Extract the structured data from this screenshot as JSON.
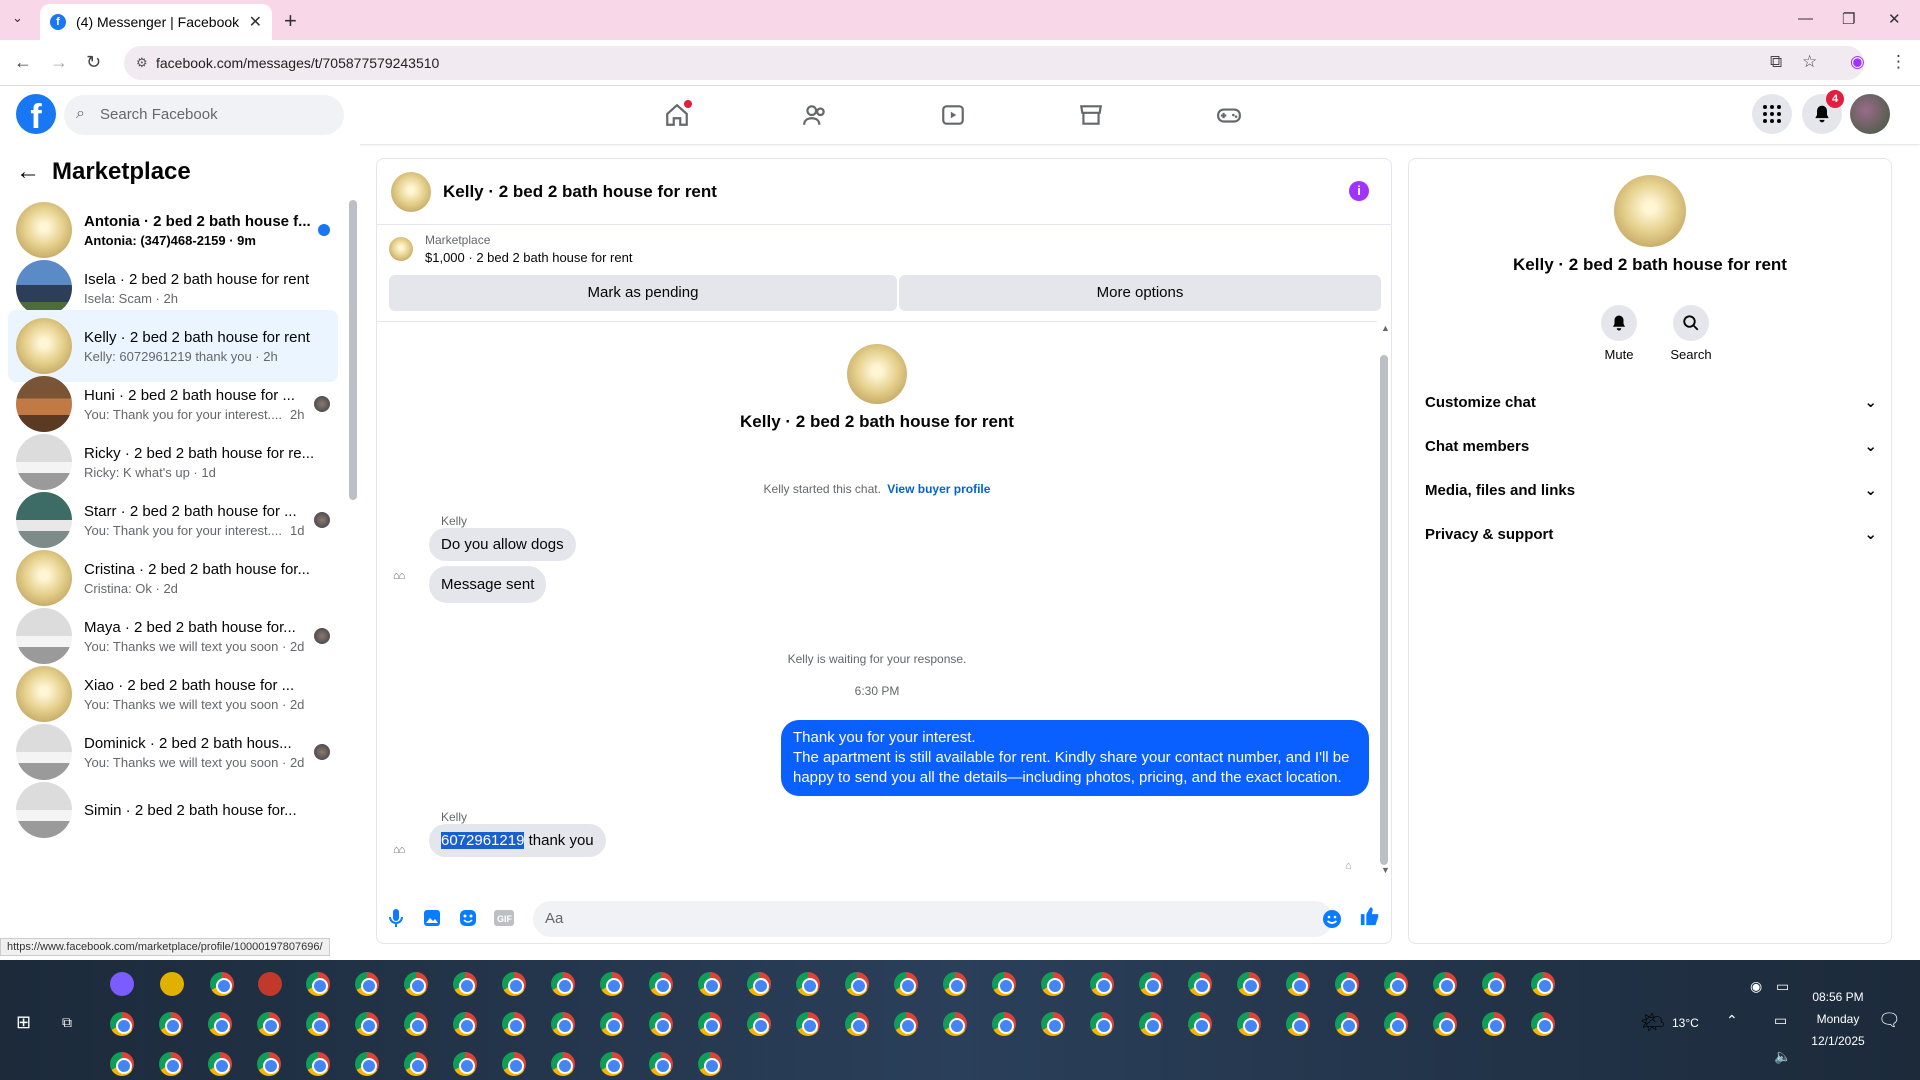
{
  "browser": {
    "tab_title": "(4) Messenger | Facebook",
    "url": "facebook.com/messages/t/705877579243510"
  },
  "fb_header": {
    "search_placeholder": "Search Facebook",
    "notification_count": "4"
  },
  "left": {
    "title": "Marketplace",
    "conversations": [
      {
        "name": "Antonia · 2 bed 2 bath house f...",
        "preview": "Antonia: (347)468-2159 · 9m",
        "thumb": "yellow",
        "unread": true
      },
      {
        "name": "Isela · 2 bed 2 bath house for rent",
        "preview": "Isela: Scam · 2h",
        "thumb": "blue"
      },
      {
        "name": "Kelly · 2 bed 2 bath house for rent",
        "preview": "Kelly: 6072961219 thank you · 2h",
        "thumb": "yellow",
        "active": true
      },
      {
        "name": "Huni · 2 bed 2 bath house for ...",
        "preview": "You: Thank you for your interest....",
        "time": "2h",
        "thumb": "brown"
      },
      {
        "name": "Ricky · 2 bed 2 bath house for re...",
        "preview": "Ricky: K what's up · 1d",
        "thumb": "white"
      },
      {
        "name": "Starr · 2 bed 2 bath house for ...",
        "preview": "You: Thank you for your interest....",
        "time": "1d",
        "thumb": "teal"
      },
      {
        "name": "Cristina · 2 bed 2 bath house for...",
        "preview": "Cristina: Ok · 2d",
        "thumb": "yellow"
      },
      {
        "name": "Maya · 2 bed 2 bath house for...",
        "preview": "You: Thanks we will text you soon · 2d",
        "thumb": "white"
      },
      {
        "name": "Xiao · 2 bed 2 bath house for ...",
        "preview": "You: Thanks we will text you soon · 2d",
        "thumb": "yellow"
      },
      {
        "name": "Dominick · 2 bed 2 bath hous...",
        "preview": "You: Thanks we will text you soon · 2d",
        "thumb": "white"
      },
      {
        "name": "Simin · 2 bed 2 bath house for...",
        "preview": "",
        "thumb": "white"
      }
    ]
  },
  "chat": {
    "title": "Kelly · 2 bed 2 bath house for rent",
    "listing_label": "Marketplace",
    "listing_price": "$1,000 · 2 bed 2 bath house for rent",
    "mark_pending": "Mark as pending",
    "more_options": "More options",
    "intro_title": "Kelly · 2 bed 2 bath house for rent",
    "started_text": "Kelly started this chat.",
    "buyer_profile_link": "View buyer profile",
    "sender_name": "Kelly",
    "msg1": "Do you allow dogs",
    "msg2": "Message sent",
    "waiting_text": "Kelly is waiting for your response.",
    "timestamp": "6:30 PM",
    "reply_line1": "Thank you for your interest.",
    "reply_line2": "The apartment is still available for rent. Kindly share your contact number, and I'll be happy to send you all the details—including photos, pricing, and the exact location.",
    "sender_name2": "Kelly",
    "last_msg_number": "6072961219",
    "last_msg_rest": " thank you",
    "input_placeholder": "Aa"
  },
  "right": {
    "title": "Kelly · 2 bed 2 bath house for rent",
    "mute": "Mute",
    "search": "Search",
    "rows": [
      "Customize chat",
      "Chat members",
      "Media, files and links",
      "Privacy & support"
    ]
  },
  "status_bar": "https://www.facebook.com/marketplace/profile/100001978076​96/",
  "taskbar": {
    "temperature": "13°C",
    "time": "08:56 PM",
    "day": "Monday",
    "date": "12/1/2025"
  }
}
